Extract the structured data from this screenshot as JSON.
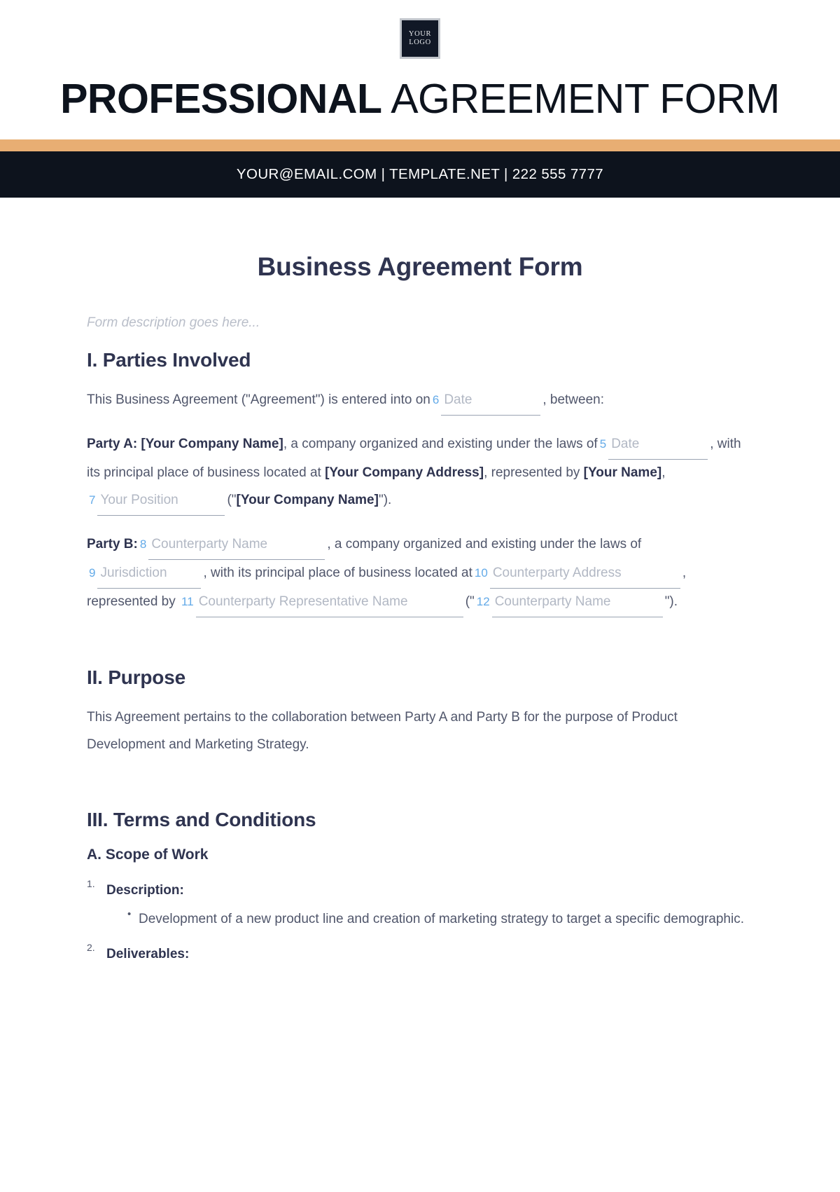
{
  "letterhead": {
    "logo": {
      "line1": "YOUR",
      "line2": "LOGO"
    },
    "brand_bold": "PROFESSIONAL",
    "brand_regular": " AGREEMENT FORM",
    "contact": "YOUR@EMAIL.COM | TEMPLATE.NET | 222 555 7777",
    "accent_color": "#E8AE73",
    "bar_color": "#0D131D"
  },
  "document": {
    "title": "Business Agreement Form",
    "description": "Form description goes here...",
    "field_number_color": "#63AAE8",
    "placeholder_color": "#B2B8C4",
    "sections": {
      "parties": {
        "heading": "I. Parties Involved",
        "intro_before": "This Business Agreement (\"Agreement\") is entered into on",
        "intro_after": ", between:",
        "party_a": {
          "label": "Party A: [Your Company Name]",
          "t1": ", a company organized and existing under the laws of",
          "t2": ", with its principal place of business located at",
          "company_address": "[Your Company Address]",
          "t3": ", represented by",
          "your_name": "[Your Name]",
          "t4": ",",
          "t5": "(\"",
          "company_name": "[Your Company Name]",
          "t6": "\")."
        },
        "party_b": {
          "label": "Party B:",
          "t1": ", a company organized and existing under the laws of",
          "t2": ", with its principal place of business located at",
          "t3": ", represented by",
          "t4": "(\"",
          "t5": "\")."
        }
      },
      "purpose": {
        "heading": "II. Purpose",
        "body": "This Agreement pertains to the collaboration between Party A and Party B for the purpose of Product Development and Marketing Strategy."
      },
      "terms": {
        "heading": "III. Terms and Conditions",
        "subsection_a": "A. Scope of Work",
        "items": [
          {
            "marker": "1.",
            "label": "Description:",
            "bullets": [
              "Development of a new product line and creation of marketing strategy to target a specific demographic."
            ]
          },
          {
            "marker": "2.",
            "label": "Deliverables:",
            "bullets": []
          }
        ]
      }
    },
    "fields": [
      {
        "num": "6",
        "placeholder": "Date"
      },
      {
        "num": "5",
        "placeholder": "Date"
      },
      {
        "num": "7",
        "placeholder": "Your Position"
      },
      {
        "num": "8",
        "placeholder": "Counterparty Name"
      },
      {
        "num": "9",
        "placeholder": "Jurisdiction"
      },
      {
        "num": "10",
        "placeholder": "Counterparty Address"
      },
      {
        "num": "11",
        "placeholder": "Counterparty Representative Name"
      },
      {
        "num": "12",
        "placeholder": "Counterparty Name"
      }
    ]
  }
}
